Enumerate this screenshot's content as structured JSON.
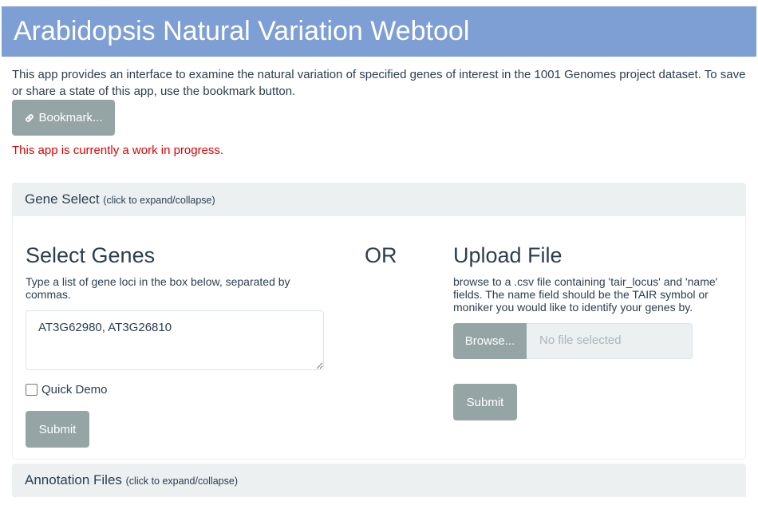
{
  "app": {
    "title": "Arabidopsis Natural Variation Webtool",
    "intro": "This app provides an interface to examine the natural variation of specified genes of interest in the 1001 Genomes project dataset. To save or share a state of this app, use the bookmark button.",
    "bookmark_label": "Bookmark...",
    "bookmark_icon": "link-icon",
    "wip_notice": "This app is currently a work in progress.",
    "wip_color": "#e00000",
    "header_color": "#7d9fd3"
  },
  "gene_panel": {
    "title": "Gene Select",
    "hint": "(click to expand/collapse)",
    "select": {
      "heading": "Select Genes",
      "help": "Type a list of gene loci in the box below, separated by commas.",
      "value": "AT3G62980, AT3G26810",
      "demo_label": "Quick Demo",
      "demo_checked": false,
      "submit_label": "Submit"
    },
    "or_label": "OR",
    "upload": {
      "heading": "Upload File",
      "help": "browse to a .csv file containing 'tair_locus' and 'name' fields. The name field should be the TAIR symbol or moniker you would like to identify your genes by.",
      "browse_label": "Browse...",
      "file_placeholder": "No file selected",
      "submit_label": "Submit"
    }
  },
  "annotation_panel": {
    "title": "Annotation Files",
    "hint": "(click to expand/collapse)"
  },
  "colors": {
    "button_bg": "#95a5a6",
    "panel_heading_bg": "#ecf0f1",
    "text": "#2c3e50"
  }
}
